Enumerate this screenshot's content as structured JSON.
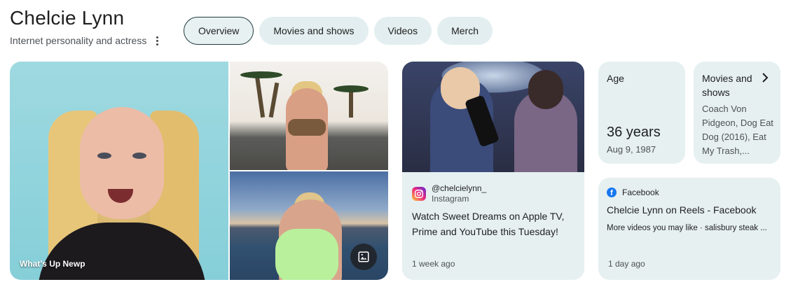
{
  "header": {
    "title": "Chelcie Lynn",
    "subtitle": "Internet personality and actress"
  },
  "tabs": [
    {
      "label": "Overview",
      "active": true
    },
    {
      "label": "Movies and shows",
      "active": false
    },
    {
      "label": "Videos",
      "active": false
    },
    {
      "label": "Merch",
      "active": false
    }
  ],
  "photos": {
    "main_caption": "What's Up Newp",
    "image_button_icon": "image-icon"
  },
  "social_post": {
    "handle": "@chelcielynn_",
    "platform": "Instagram",
    "text": "Watch Sweet Dreams on Apple TV, Prime and YouTube this Tuesday!",
    "time": "1 week ago"
  },
  "age": {
    "label": "Age",
    "value": "36 years",
    "date": "Aug 9, 1987"
  },
  "movies": {
    "label": "Movies and shows",
    "list": "Coach Von Pidgeon, Dog Eat Dog (2016), Eat My Trash,..."
  },
  "facebook": {
    "source": "Facebook",
    "title": "Chelcie Lynn on Reels - Facebook",
    "description": "More videos you may like · salisbury steak ...",
    "time": "1 day ago"
  },
  "colors": {
    "chip_bg": "#e3eef0",
    "card_bg": "#e6f0f1",
    "facebook_blue": "#1877f2"
  }
}
